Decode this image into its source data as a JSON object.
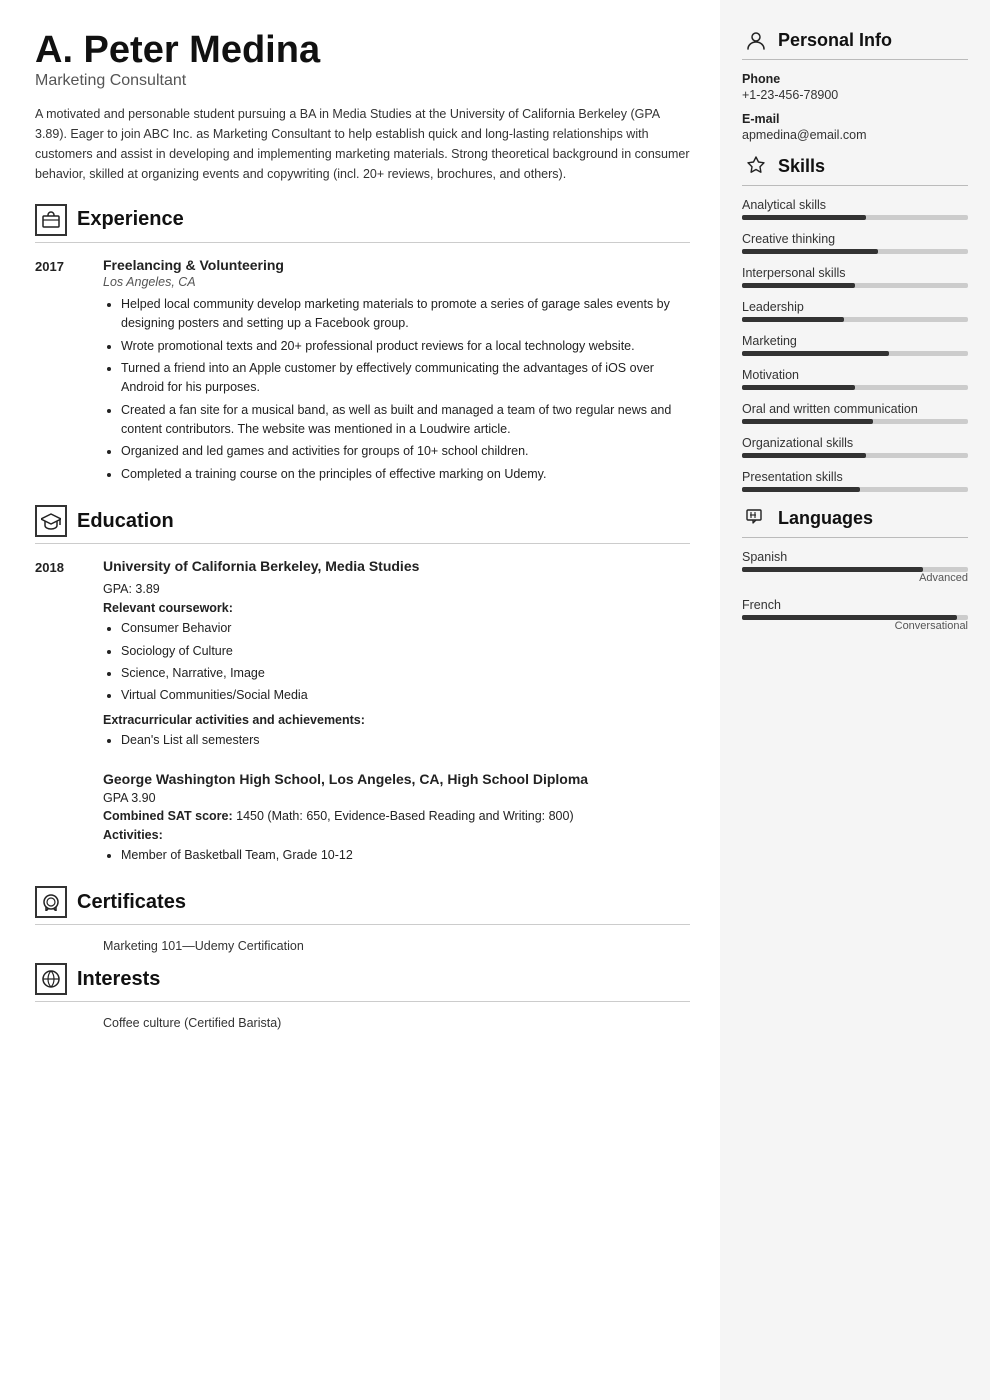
{
  "header": {
    "name": "A. Peter Medina",
    "title": "Marketing Consultant",
    "summary": "A motivated and personable student pursuing a BA in Media Studies at the University of California Berkeley (GPA 3.89). Eager to join ABC Inc. as Marketing Consultant to help establish quick and long-lasting relationships with customers and assist in developing and implementing marketing materials. Strong theoretical background in consumer behavior, skilled at organizing events and copywriting (incl. 20+ reviews, brochures, and others)."
  },
  "sections": {
    "experience": {
      "label": "Experience",
      "entries": [
        {
          "year": "2017",
          "title": "Freelancing & Volunteering",
          "subtitle": "Los Angeles, CA",
          "bullets": [
            "Helped local community develop marketing materials to promote a series of garage sales events by designing posters and setting up a Facebook group.",
            "Wrote promotional texts and 20+ professional product reviews for a local technology website.",
            "Turned a friend into an Apple customer by effectively communicating the advantages of iOS over Android for his purposes.",
            "Created a fan site for a musical band, as well as built and managed a team of two regular news and content contributors. The website was mentioned in a Loudwire article.",
            "Organized and led games and activities for groups of 10+ school children.",
            "Completed a training course on the principles of effective marking on Udemy."
          ]
        }
      ]
    },
    "education": {
      "label": "Education",
      "entries": [
        {
          "year": "2018",
          "title": "University of California Berkeley, Media Studies",
          "subtitle": "",
          "gpa": "GPA: 3.89",
          "coursework_label": "Relevant coursework:",
          "coursework": [
            "Consumer Behavior",
            "Sociology of Culture",
            "Science, Narrative, Image",
            "Virtual Communities/Social Media"
          ],
          "extra_label": "Extracurricular activities and achievements:",
          "extra": [
            "Dean's List all semesters"
          ]
        },
        {
          "year": "",
          "title": "George Washington High School, Los Angeles, CA, High School Diploma",
          "subtitle": "",
          "gpa": "GPA 3.90",
          "sat_label": "Combined SAT score:",
          "sat": "1450 (Math: 650, Evidence-Based Reading and Writing: 800)",
          "activities_label": "Activities:",
          "activities": [
            "Member of Basketball Team, Grade 10-12"
          ]
        }
      ]
    },
    "certificates": {
      "label": "Certificates",
      "items": [
        "Marketing 101—Udemy Certification"
      ]
    },
    "interests": {
      "label": "Interests",
      "items": [
        "Coffee culture (Certified Barista)"
      ]
    }
  },
  "sidebar": {
    "personal_info": {
      "label": "Personal Info",
      "phone_label": "Phone",
      "phone": "+1-23-456-78900",
      "email_label": "E-mail",
      "email": "apmedina@email.com"
    },
    "skills": {
      "label": "Skills",
      "items": [
        {
          "name": "Analytical skills",
          "pct": 55
        },
        {
          "name": "Creative thinking",
          "pct": 60
        },
        {
          "name": "Interpersonal skills",
          "pct": 50
        },
        {
          "name": "Leadership",
          "pct": 45
        },
        {
          "name": "Marketing",
          "pct": 65
        },
        {
          "name": "Motivation",
          "pct": 50
        },
        {
          "name": "Oral and written communication",
          "pct": 58
        },
        {
          "name": "Organizational skills",
          "pct": 55
        },
        {
          "name": "Presentation skills",
          "pct": 52
        }
      ]
    },
    "languages": {
      "label": "Languages",
      "items": [
        {
          "name": "Spanish",
          "level": "Advanced",
          "pct": 80
        },
        {
          "name": "French",
          "level": "Conversational",
          "pct": 95
        }
      ]
    }
  }
}
